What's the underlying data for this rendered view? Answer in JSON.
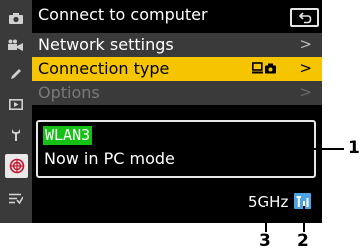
{
  "header": {
    "title": "Connect to computer"
  },
  "menu": {
    "items": [
      {
        "label": "Network settings",
        "state": "normal"
      },
      {
        "label": "Connection type",
        "state": "selected"
      },
      {
        "label": "Options",
        "state": "disabled"
      }
    ],
    "chevron": ">"
  },
  "network": {
    "ssid": "WLAN3",
    "status": "Now in PC mode",
    "band": "5GHz",
    "signal_icon": "wifi-signal-bars-icon"
  },
  "callouts": [
    "1",
    "2",
    "3"
  ],
  "colors": {
    "selected": "#f4c500",
    "ssid_highlight": "#16c116",
    "signal": "#4ba3e6",
    "sidebar": "#3a3a3a"
  },
  "sidebar": {
    "icons": [
      "camera-icon",
      "movie-icon",
      "pencil-icon",
      "playback-icon",
      "setup-wrench-icon",
      "network-globe-icon",
      "my-menu-icon"
    ]
  }
}
